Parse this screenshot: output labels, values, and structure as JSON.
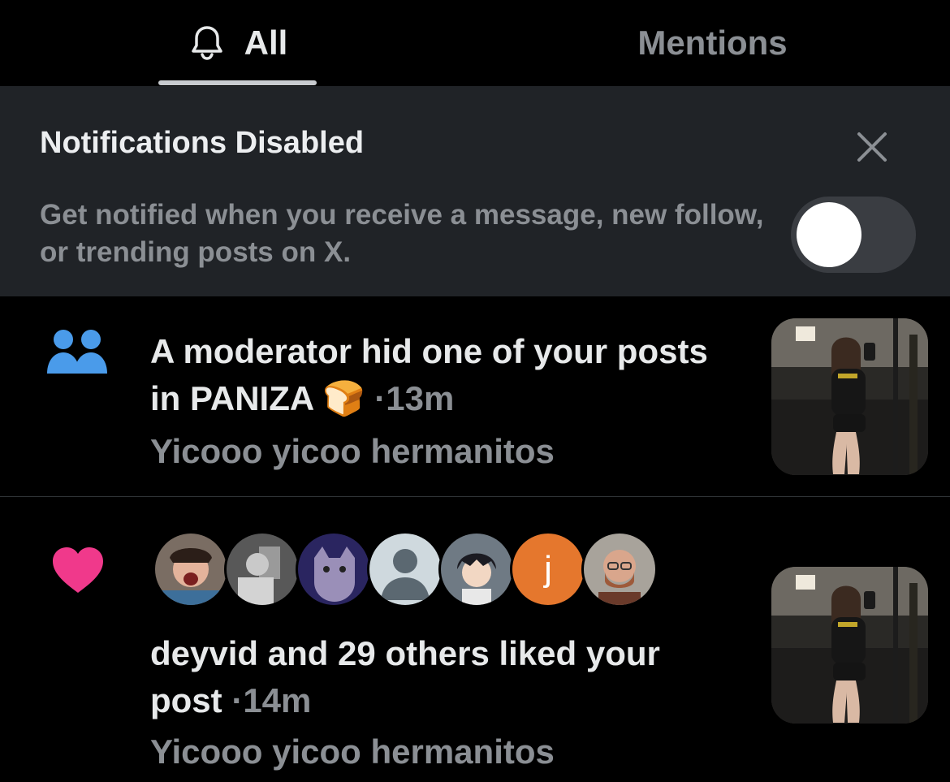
{
  "tabs": [
    {
      "label": "All",
      "icon": "bell-icon",
      "active": true
    },
    {
      "label": "Mentions",
      "active": false
    }
  ],
  "banner": {
    "title": "Notifications Disabled",
    "text": "Get notified when you receive a message, new follow, or trending posts on X.",
    "toggle_on": false
  },
  "notifications": [
    {
      "icon": "community-icon",
      "title": "A moderator hid one of your posts in PANIZA 🍞",
      "time": "13m",
      "subtitle": "Yicooo yicoo hermanitos"
    },
    {
      "icon": "heart-icon",
      "title": "deyvid and 29 others liked your post",
      "time": "14m",
      "subtitle": "Yicooo yicoo hermanitos",
      "avatar_letter": "j"
    }
  ],
  "colors": {
    "accent_blue": "#4a9bea",
    "heart_pink": "#f0398b",
    "banner_bg": "#202327"
  }
}
